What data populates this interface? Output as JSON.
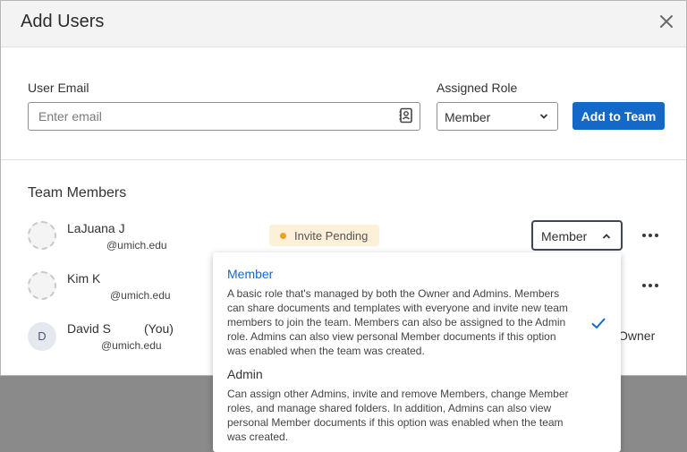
{
  "modal": {
    "title": "Add Users",
    "close_icon": "close-icon"
  },
  "form": {
    "email_label": "User Email",
    "email_placeholder": "Enter email",
    "email_value": "",
    "contact_icon": "address-book-icon",
    "role_label": "Assigned Role",
    "role_value": "Member",
    "add_button_label": "Add to Team"
  },
  "team": {
    "title": "Team Members",
    "members": [
      {
        "name": "LaJuana J",
        "email": "@umich.edu",
        "avatar_initial": "",
        "status": "Invite Pending",
        "role": "Member"
      },
      {
        "name": "Kim K",
        "email": "@umich.edu",
        "avatar_initial": ""
      },
      {
        "name": "David S",
        "you_tag": "(You)",
        "email": "@umich.edu",
        "avatar_initial": "D",
        "role": "Owner"
      }
    ]
  },
  "role_dropdown": {
    "selected": "Member",
    "options": [
      {
        "title": "Member",
        "description": "A basic role that's managed by both the Owner and Admins. Members can share documents and templates with everyone and invite new team members to join the team. Members can also be assigned to the Admin role. Admins can also view personal Member documents if this option was enabled when the team was created."
      },
      {
        "title": "Admin",
        "description": "Can assign other Admins, invite and remove Members, change Member roles, and manage shared folders. In addition, Admins can also view personal Member documents if this option was enabled when the team was created."
      }
    ]
  },
  "colors": {
    "accent": "#1468c7",
    "pending_badge_bg": "#fdf0d9",
    "pending_dot": "#f0a020",
    "backdrop": "#8a8a8a"
  }
}
